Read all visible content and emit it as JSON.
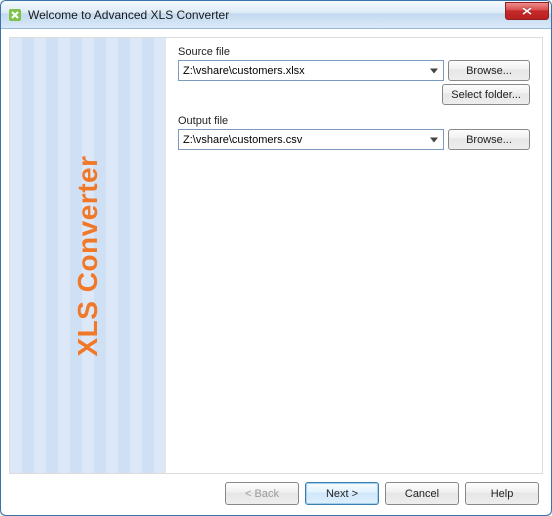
{
  "window": {
    "title": "Welcome to Advanced XLS Converter"
  },
  "banner": {
    "text": "XLS Converter"
  },
  "source": {
    "label": "Source file",
    "value": "Z:\\vshare\\customers.xlsx",
    "browse": "Browse...",
    "select_folder": "Select folder..."
  },
  "output": {
    "label": "Output file",
    "value": "Z:\\vshare\\customers.csv",
    "browse": "Browse..."
  },
  "footer": {
    "back": "< Back",
    "next": "Next >",
    "cancel": "Cancel",
    "help": "Help"
  }
}
